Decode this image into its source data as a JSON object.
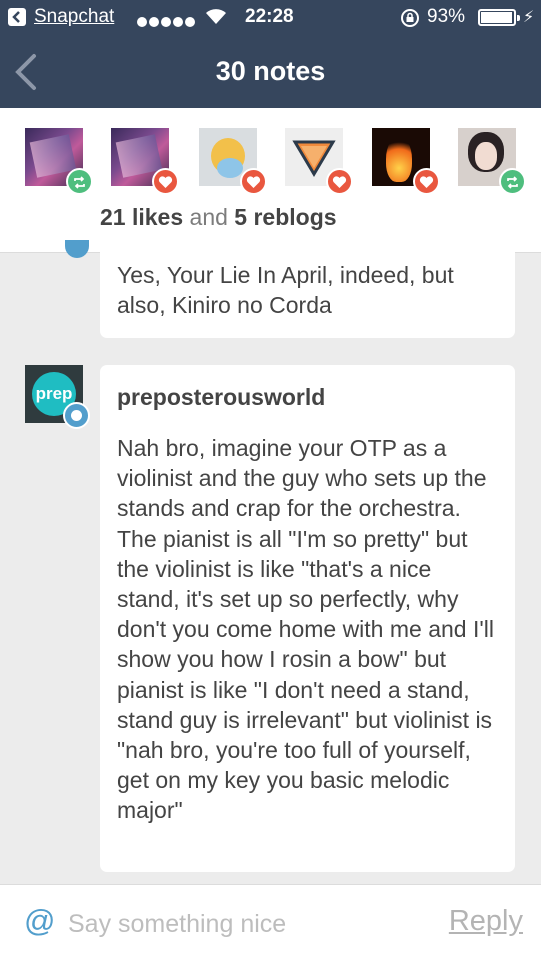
{
  "status_bar": {
    "app_name": "Snapchat",
    "time": "22:28",
    "battery_percent": "93%",
    "signal_dots": 5,
    "battery_level": 0.93
  },
  "header": {
    "title": "30 notes",
    "back_icon": "chevron-left-icon"
  },
  "summary": {
    "avatars": [
      {
        "type": "reblog",
        "badge_icon": "reblog-icon"
      },
      {
        "type": "like",
        "badge_icon": "heart-icon"
      },
      {
        "type": "like",
        "badge_icon": "heart-icon"
      },
      {
        "type": "like",
        "badge_icon": "heart-icon"
      },
      {
        "type": "like",
        "badge_icon": "heart-icon"
      },
      {
        "type": "reblog",
        "badge_icon": "reblog-icon"
      }
    ],
    "likes_label": "21 likes",
    "and_label": "and",
    "reblogs_label": "5 reblogs"
  },
  "notes": [
    {
      "username": "",
      "text": "Yes, Your Lie In April, indeed, but also, Kiniro no Corda"
    },
    {
      "username": "preposterousworld",
      "avatar_text": "prep",
      "text": "Nah bro, imagine your OTP as a violinist and the guy who sets up the stands and crap for the orchestra. The pianist is all \"I'm so pretty\" but the violinist is like \"that's a nice stand, it's set up so perfectly, why don't you come home with me and I'll show you how I rosin a bow\" but pianist is like \"I don't need a stand, stand guy is irrelevant\" but violinist is \"nah bro, you're too full of yourself, get on my key you basic melodic major\""
    }
  ],
  "reply_bar": {
    "at_symbol": "@",
    "placeholder": "Say something nice",
    "reply_label": "Reply"
  },
  "colors": {
    "nav_bg": "#36465d",
    "like": "#e9573f",
    "reblog": "#4ebe7e",
    "reply": "#529ecc"
  }
}
